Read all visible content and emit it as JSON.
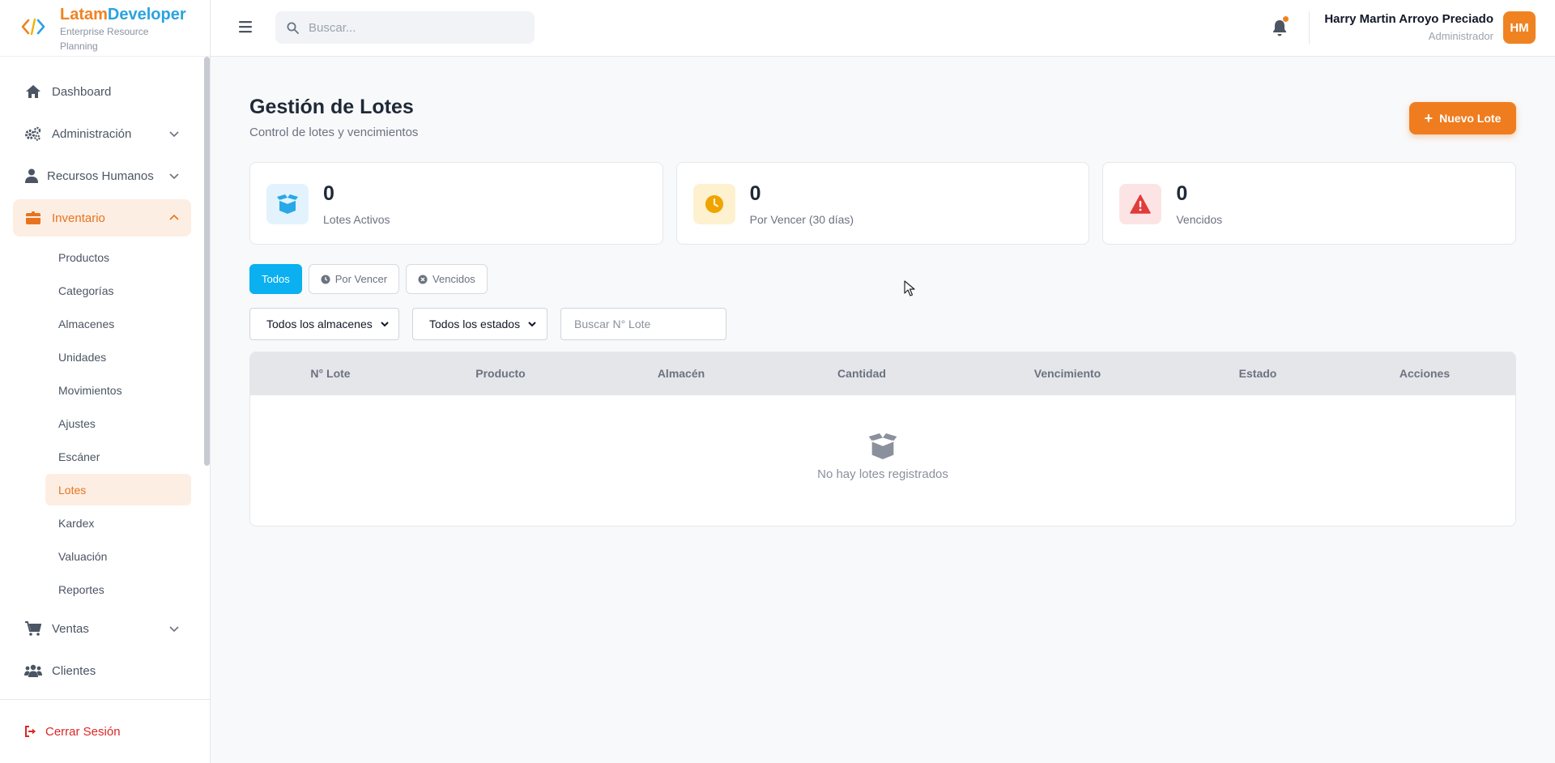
{
  "brand": {
    "name_part1": "Latam",
    "name_part2": "Developer",
    "subtitle": "Enterprise Resource Planning"
  },
  "sidebar": {
    "items": [
      {
        "label": "Dashboard",
        "icon": "home-icon"
      },
      {
        "label": "Administración",
        "icon": "cogs-icon",
        "expandable": true
      },
      {
        "label": "Recursos Humanos",
        "icon": "user-tie-icon",
        "expandable": true
      },
      {
        "label": "Inventario",
        "icon": "boxes-icon",
        "expandable": true,
        "expanded": true,
        "active": true
      },
      {
        "label": "Ventas",
        "icon": "cart-icon",
        "expandable": true
      },
      {
        "label": "Clientes",
        "icon": "users-icon"
      }
    ],
    "inventario_sub": [
      "Productos",
      "Categorías",
      "Almacenes",
      "Unidades",
      "Movimientos",
      "Ajustes",
      "Escáner",
      "Lotes",
      "Kardex",
      "Valuación",
      "Reportes"
    ],
    "active_sub": "Lotes",
    "logout_label": "Cerrar Sesión"
  },
  "topbar": {
    "search_placeholder": "Buscar...",
    "user_name": "Harry Martin Arroyo Preciado",
    "user_role": "Administrador",
    "avatar_initials": "HM"
  },
  "page": {
    "title": "Gestión de Lotes",
    "subtitle": "Control de lotes y vencimientos",
    "new_button": "Nuevo Lote"
  },
  "stats": [
    {
      "value": "0",
      "label": "Lotes Activos",
      "icon": "box-open-icon",
      "color": "#29a8e8",
      "bg": "#e3f3fd"
    },
    {
      "value": "0",
      "label": "Por Vencer (30 días)",
      "icon": "clock-icon",
      "color": "#f0a400",
      "bg": "#fdf1cf"
    },
    {
      "value": "0",
      "label": "Vencidos",
      "icon": "warning-icon",
      "color": "#e23b3b",
      "bg": "#fde4e4"
    }
  ],
  "tabs": [
    {
      "label": "Todos",
      "active": true
    },
    {
      "label": "Por Vencer",
      "icon": "clock-icon"
    },
    {
      "label": "Vencidos",
      "icon": "times-circle-icon"
    }
  ],
  "filters": {
    "warehouse": "Todos los almacenes",
    "status": "Todos los estados",
    "lot_placeholder": "Buscar N° Lote"
  },
  "table": {
    "columns": [
      "N° Lote",
      "Producto",
      "Almacén",
      "Cantidad",
      "Vencimiento",
      "Estado",
      "Acciones"
    ],
    "empty_text": "No hay lotes registrados"
  },
  "colors": {
    "accent": "#ef7d1f",
    "primary_tab": "#0ab0f0",
    "danger": "#dc2626"
  }
}
